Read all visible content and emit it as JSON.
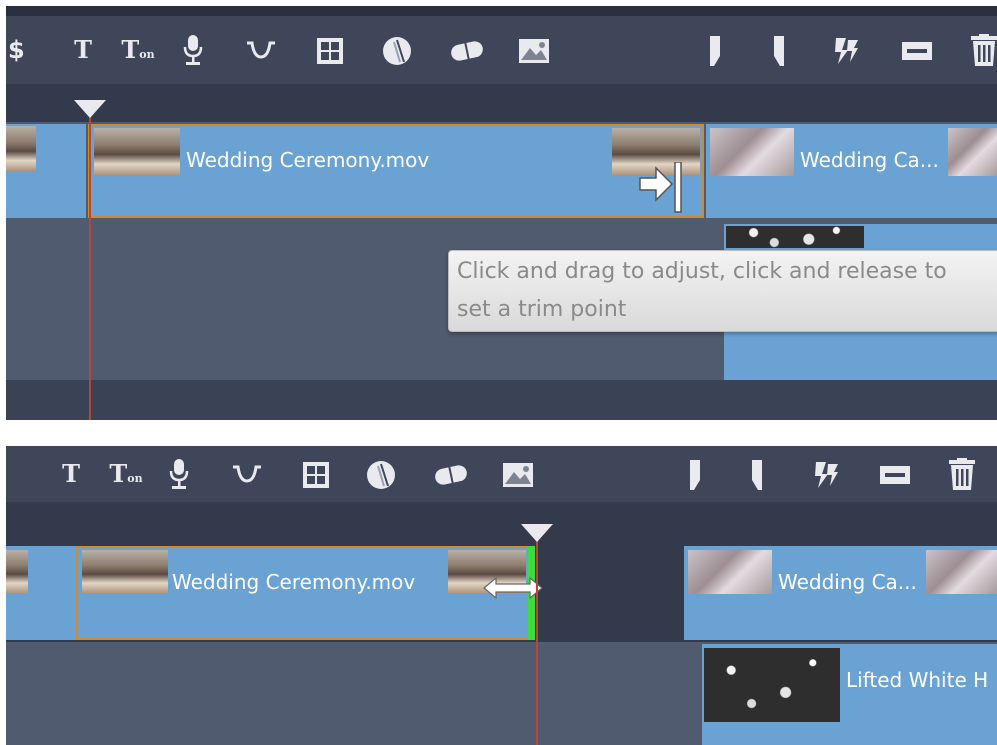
{
  "toolbar": {
    "icons": [
      "magic-icon",
      "title-icon",
      "title-motion-icon",
      "voiceover-microphone-icon",
      "transition-icon",
      "montage-grid-icon",
      "disc-menu-icon",
      "pill-link-icon",
      "image-effect-icon",
      "mark-in-icon",
      "mark-out-icon",
      "split-clip-icon",
      "razor-block-icon",
      "trash-icon"
    ],
    "title_glyph": "T",
    "title_motion_glyph": "T",
    "title_motion_sub": "on",
    "magic_glyph": "$"
  },
  "panel_top": {
    "clips": [
      {
        "label": "Wedding Ceremony.mov",
        "selected": true
      },
      {
        "label": "Wedding Ca..."
      }
    ],
    "tooltip_line1": "Click and drag to adjust, click and release to",
    "tooltip_line2": "set a trim point"
  },
  "panel_bottom": {
    "clips": [
      {
        "label": "Wedding Ceremony.mov",
        "selected": true
      },
      {
        "label": "Wedding Ca..."
      },
      {
        "label": "Lifted White H"
      }
    ]
  },
  "colors": {
    "clip_blue": "#6aa3d3",
    "selection_orange": "#d38a2a",
    "trim_green": "#3ddc3d",
    "playhead_red": "#b04a3a",
    "toolbar_bg": "#3f4659",
    "track_bg": "#505b70"
  }
}
